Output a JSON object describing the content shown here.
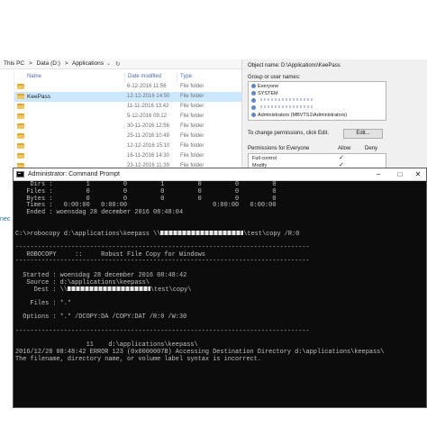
{
  "explorer": {
    "breadcrumbs": [
      "This PC",
      ">",
      "Data (D:)",
      ">",
      "Applications"
    ],
    "dropdown_glyph": "⌄",
    "refresh_glyph": "↻",
    "columns": {
      "name": "Name",
      "date": "Date modified",
      "type": "Type"
    },
    "nav_stub": "nec",
    "rows": [
      {
        "name": "",
        "date": "6-12-2016 11:56",
        "type": "File folder",
        "selected": false
      },
      {
        "name": "KeePass",
        "date": "12-12-2016 14:50",
        "type": "File folder",
        "selected": true
      },
      {
        "name": "",
        "date": "11-11-2016 13:42",
        "type": "File folder",
        "selected": false
      },
      {
        "name": "",
        "date": "5-12-2016 09:12",
        "type": "File folder",
        "selected": false
      },
      {
        "name": "",
        "date": "30-11-2016 12:56",
        "type": "File folder",
        "selected": false
      },
      {
        "name": "",
        "date": "25-11-2016 10:48",
        "type": "File folder",
        "selected": false
      },
      {
        "name": "",
        "date": "12-12-2016 15:10",
        "type": "File folder",
        "selected": false
      },
      {
        "name": "",
        "date": "16-11-2016 14:30",
        "type": "File folder",
        "selected": false
      },
      {
        "name": "",
        "date": "23-12-2016 11:39",
        "type": "File folder",
        "selected": false
      }
    ]
  },
  "security": {
    "object_label": "Object name:",
    "object_value": "D:\\Applications\\KeePass",
    "group_label": "Group or user names:",
    "users": [
      "Everyone",
      "SYSTEM",
      "",
      "",
      "Administrators (MBVTS1\\Administrators)"
    ],
    "change_text": "To change permissions, click Edit.",
    "edit_label": "Edit...",
    "perm_for": "Permissions for Everyone",
    "allow": "Allow",
    "deny": "Deny",
    "perms": [
      {
        "name": "Full control",
        "allow": "✓"
      },
      {
        "name": "Modify",
        "allow": "✓"
      }
    ]
  },
  "cmd": {
    "title": "Administrator: Command Prompt",
    "controls": {
      "minimize": "–",
      "maximize": "□",
      "close": "✕"
    },
    "lines": [
      {
        "text": "    Dirs :         1         0         1         0         0         0"
      },
      {
        "text": "   Files :         0         0         0         0         0         0"
      },
      {
        "text": "   Bytes :         0         0         0         0         0         0"
      },
      {
        "text": "   Times :   0:00:00   0:00:00                       0:00:00   0:00:00"
      },
      {
        "text": "   Ended : woensdag 28 december 2016 08:48:04"
      },
      {
        "text": ""
      },
      {
        "text": ""
      },
      {
        "text": "C:\\>robocopy d:\\applications\\keepass \\\\",
        "redact": true,
        "after": "\\test\\copy /R:0"
      },
      {
        "text": ""
      },
      {
        "text": "-------------------------------------------------------------------------------"
      },
      {
        "text": "   ROBOCOPY     ::     Robust File Copy for Windows"
      },
      {
        "text": "-------------------------------------------------------------------------------"
      },
      {
        "text": ""
      },
      {
        "text": "  Started : woensdag 28 december 2016 08:48:42"
      },
      {
        "text": "   Source : d:\\applications\\keepass\\"
      },
      {
        "text": "     Dest : \\\\",
        "redact": true,
        "after": "\\test\\copy\\"
      },
      {
        "text": ""
      },
      {
        "text": "    Files : *.*"
      },
      {
        "text": ""
      },
      {
        "text": "  Options : *.* /DCOPY:DA /COPY:DAT /R:0 /W:30"
      },
      {
        "text": ""
      },
      {
        "text": "-------------------------------------------------------------------------------"
      },
      {
        "text": ""
      },
      {
        "text": "                   11    d:\\applications\\keepass\\"
      },
      {
        "text": "2016/12/28 08:48:42 ERROR 123 (0x0000007B) Accessing Destination Directory d:\\applications\\keepass\\"
      },
      {
        "text": "The filename, directory name, or volume label syntax is incorrect."
      }
    ]
  }
}
